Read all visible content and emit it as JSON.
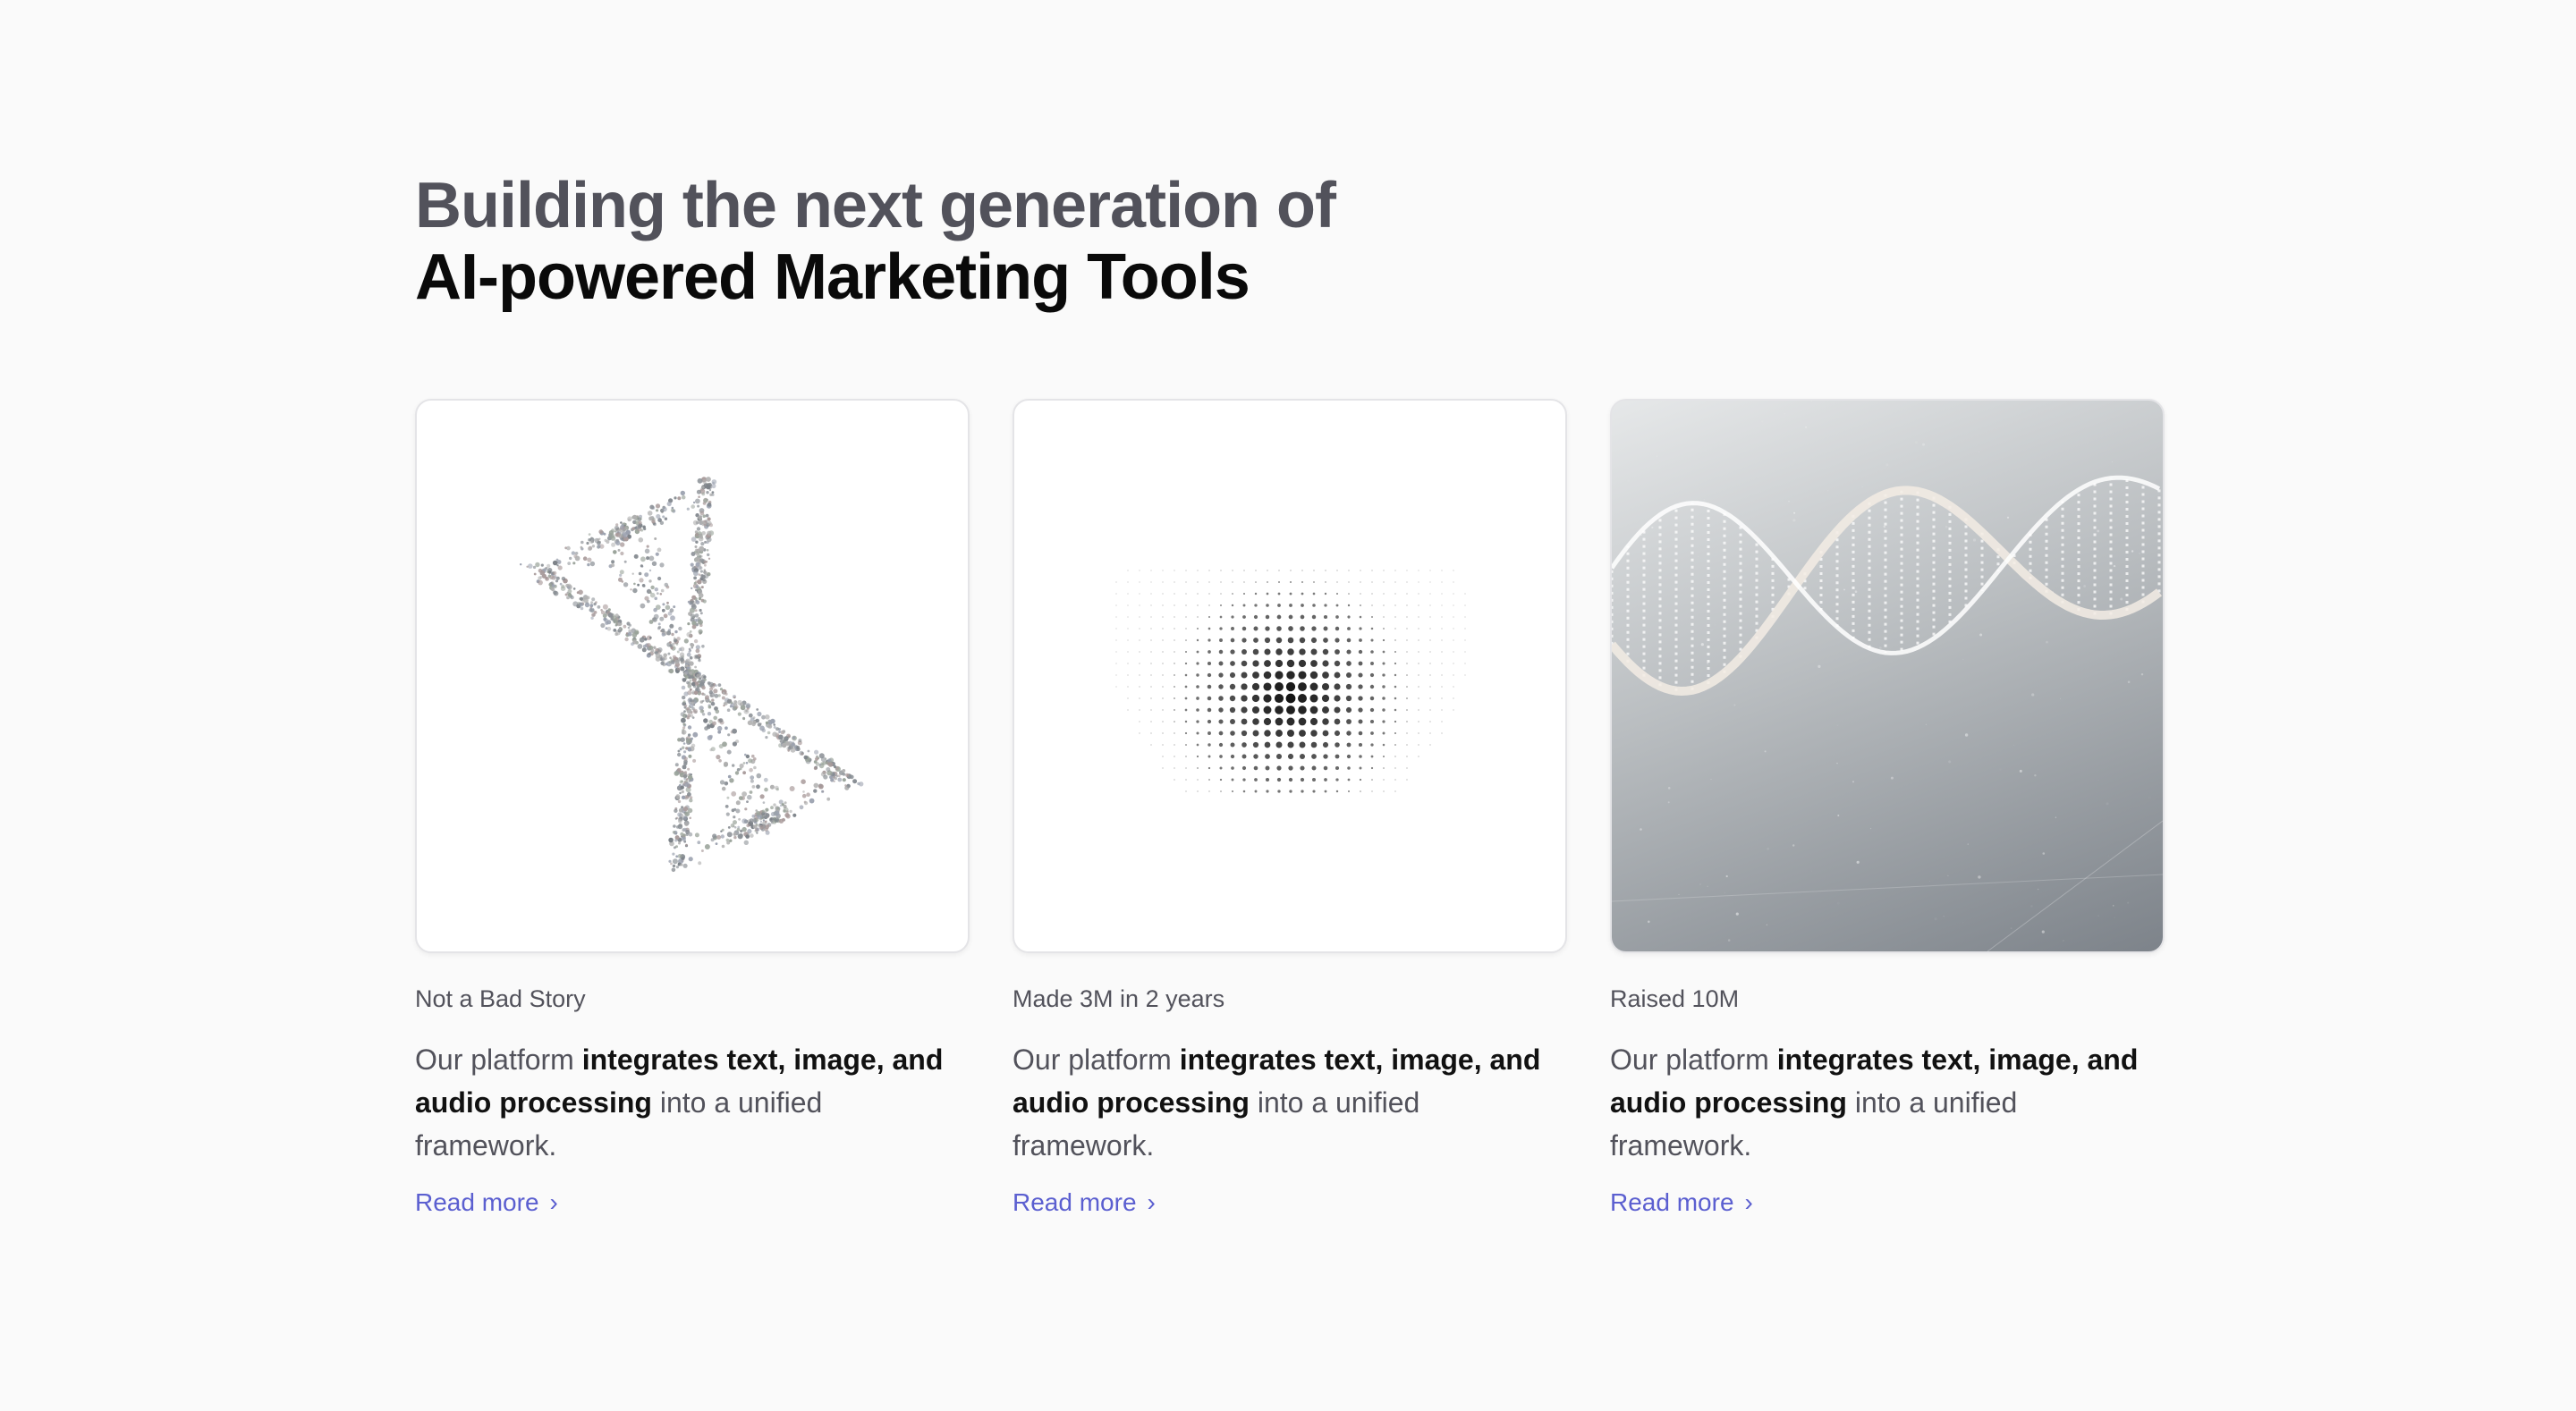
{
  "heading": {
    "line1": "Building the next generation of",
    "line2": "AI-powered Marketing Tools"
  },
  "cards": [
    {
      "label": "Not a Bad Story",
      "desc_pre": "Our platform ",
      "desc_bold1": "integrates text, image, and",
      "desc_bold2": "audio processing",
      "desc_post": " into a unified framework.",
      "link": "Read more",
      "image": "hourglass-particles"
    },
    {
      "label": "Made 3M in 2 years",
      "desc_pre": "Our platform ",
      "desc_bold1": "integrates text, image, and",
      "desc_bold2": "audio processing",
      "desc_post": " into a unified framework.",
      "link": "Read more",
      "image": "dot-heart"
    },
    {
      "label": "Raised 10M",
      "desc_pre": "Our platform ",
      "desc_bold1": "integrates text, image, and",
      "desc_bold2": "audio processing",
      "desc_post": " into a unified framework.",
      "link": "Read more",
      "image": "dna-helix"
    }
  ],
  "colors": {
    "link": "#5b5fd0",
    "muted": "#52525b"
  }
}
